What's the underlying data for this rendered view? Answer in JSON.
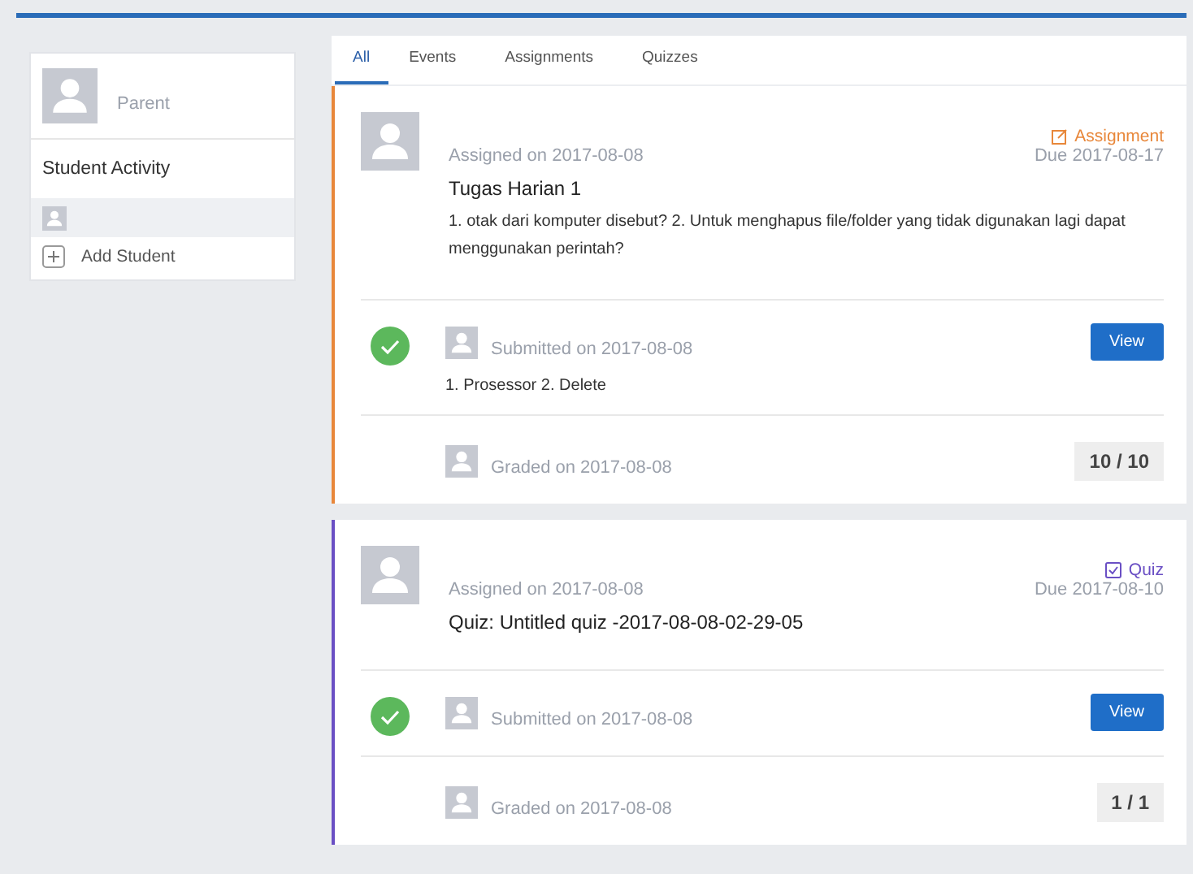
{
  "profile": {
    "role": "Parent"
  },
  "sidebar": {
    "title": "Student Activity",
    "students": [
      {
        "selected": true
      }
    ],
    "add_label": "Add Student"
  },
  "tabs": [
    {
      "label": "All",
      "selected": true
    },
    {
      "label": "Events",
      "selected": false
    },
    {
      "label": "Assignments",
      "selected": false
    },
    {
      "label": "Quizzes",
      "selected": false
    }
  ],
  "items": [
    {
      "kind": "assignment",
      "type_label": "Assignment",
      "color": "#e8873a",
      "assigned": "Assigned on 2017-08-08",
      "due": "Due 2017-08-17",
      "title": "Tugas Harian 1",
      "description": "1. otak dari komputer disebut? 2. Untuk menghapus file/folder yang tidak digunakan lagi dapat menggunakan perintah?",
      "submission": {
        "done": true,
        "date": "Submitted on 2017-08-08",
        "answer": "1. Prosessor 2. Delete",
        "button": "View"
      },
      "grade": {
        "date": "Graded on 2017-08-08",
        "score": "10 / 10"
      }
    },
    {
      "kind": "quiz",
      "type_label": "Quiz",
      "color": "#6a4fc4",
      "assigned": "Assigned on 2017-08-08",
      "due": "Due 2017-08-10",
      "title": "Quiz: Untitled quiz -2017-08-08-02-29-05",
      "submission": {
        "done": true,
        "date": "Submitted on 2017-08-08",
        "button": "View"
      },
      "grade": {
        "date": "Graded on 2017-08-08",
        "score": "1 / 1"
      }
    }
  ]
}
